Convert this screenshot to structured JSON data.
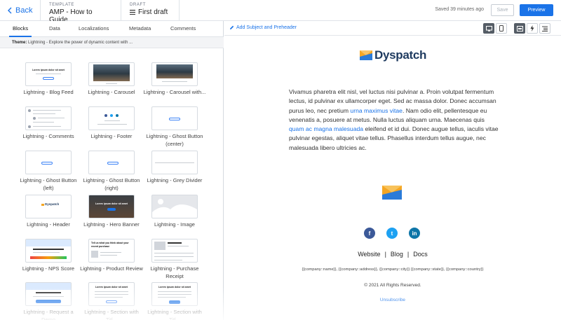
{
  "topbar": {
    "back_label": "Back",
    "template_label": "TEMPLATE",
    "template_name": "AMP - How to Guide",
    "draft_label": "DRAFT",
    "draft_name": "First draft",
    "saved_status": "Saved 39 minutes ago",
    "save_label": "Save",
    "preview_label": "Preview"
  },
  "sidebar": {
    "tabs": [
      "Blocks",
      "Data",
      "Localizations",
      "Metadata",
      "Comments"
    ],
    "active_tab": "Blocks",
    "theme_label": "Theme:",
    "theme_text": "Lightning - Explore the power of dynamic content with ..."
  },
  "blocks": [
    {
      "label": "Lightning - Blog Feed",
      "thumb_text": "Lorem ipsum dolor sit amet"
    },
    {
      "label": "Lightning - Carousel"
    },
    {
      "label": "Lightning - Carousel with..."
    },
    {
      "label": "Lightning - Comments"
    },
    {
      "label": "Lightning - Footer"
    },
    {
      "label": "Lightning - Ghost Button (center)"
    },
    {
      "label": "Lightning - Ghost Button (left)"
    },
    {
      "label": "Lightning - Ghost Button (right)"
    },
    {
      "label": "Lightning - Grey Divider"
    },
    {
      "label": "Lightning - Header",
      "thumb_text": "Dyspatch"
    },
    {
      "label": "Lightning - Hero Banner",
      "thumb_text": "Lorem ipsum dolor sit amet"
    },
    {
      "label": "Lightning - Image"
    },
    {
      "label": "Lightning - NPS Score"
    },
    {
      "label": "Lightning - Product Review",
      "thumb_text": "Tell us what you think about your recent purchase"
    },
    {
      "label": "Lightning - Purchase Receipt"
    },
    {
      "label": "Lightning - Request a Demo"
    },
    {
      "label": "Lightning - Section with Titl...",
      "thumb_text": "Lorem ipsum dolor sit amet"
    },
    {
      "label": "Lightning - Section with Titl...",
      "thumb_text": "Lorem ipsum dolor sit amet"
    }
  ],
  "editor": {
    "add_subject_label": "Add Subject and Preheader",
    "logo_text": "Dyspatch",
    "body_1": "Vivamus pharetra elit nisl, vel luctus nisi pulvinar a. Proin volutpat fermentum lectus, id pulvinar ex ullamcorper eget. Sed ac massa dolor. Donec accumsan purus leo, nec pretium ",
    "link_1": "urna maximus vitae",
    "body_2": ". Nam odio elit, pellentesque eu venenatis a, posuere at metus. Nulla luctus aliquam urna. Maecenas quis ",
    "link_2": "quam ac magna malesuada",
    "body_3": " eleifend et id dui. Donec augue tellus, iaculis vitae pulvinar egestas, aliquet vitae tellus. Phasellus interdum tellus augue, nec malesuada libero ultricies ac.",
    "footer_links": [
      "Website",
      "Blog",
      "Docs"
    ],
    "footer_sep": "|",
    "merge_tags": "{{company::name}}, {{company::address}}, {{company::city}} {{company::state}}, {{company::country}}",
    "copyright": "© 2021 All Rights Reserved.",
    "unsubscribe": "Unsubscribe",
    "social": [
      {
        "icon": "facebook-icon",
        "glyph": "f",
        "color": "#3b5998"
      },
      {
        "icon": "twitter-icon",
        "glyph": "t",
        "color": "#1da1f2"
      },
      {
        "icon": "linkedin-icon",
        "glyph": "in",
        "color": "#0e76a8"
      }
    ]
  },
  "colors": {
    "accent": "#1a73e8",
    "logo_orange": "#f5a623",
    "logo_blue": "#1e3a5f"
  }
}
